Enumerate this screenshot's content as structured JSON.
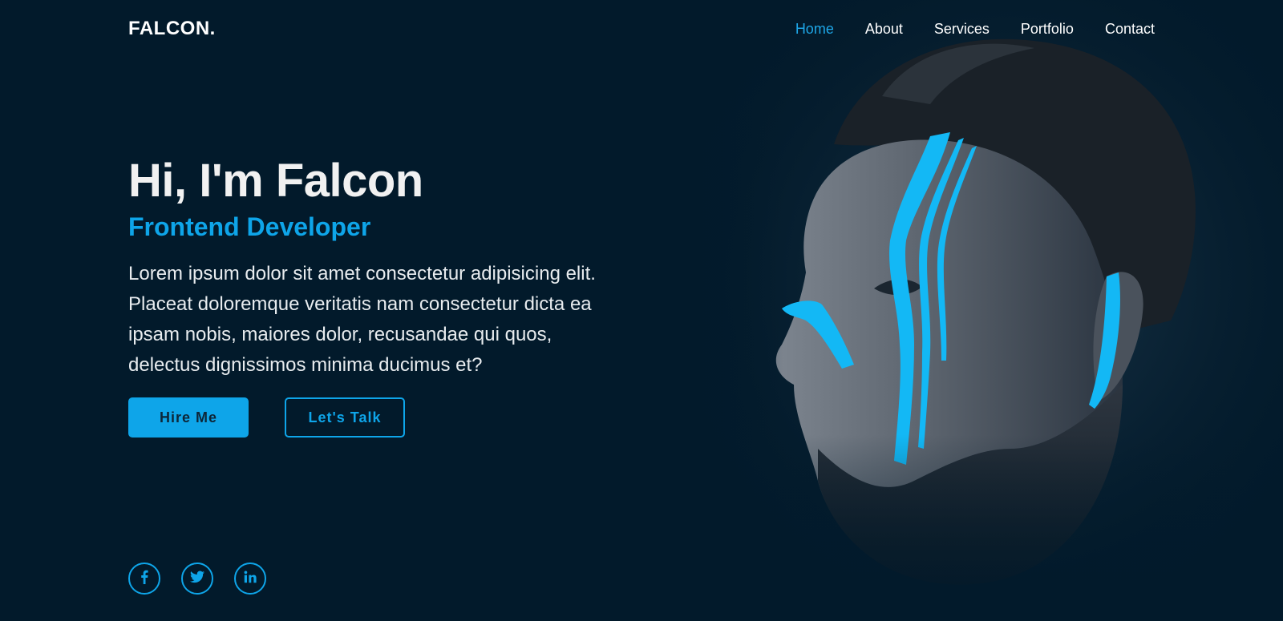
{
  "brand": {
    "logo": "FALCON."
  },
  "nav": {
    "items": [
      {
        "label": "Home",
        "active": true
      },
      {
        "label": "About",
        "active": false
      },
      {
        "label": "Services",
        "active": false
      },
      {
        "label": "Portfolio",
        "active": false
      },
      {
        "label": "Contact",
        "active": false
      }
    ]
  },
  "hero": {
    "title": "Hi, I'm Falcon",
    "subtitle": "Frontend Developer",
    "description": "Lorem ipsum dolor sit amet consectetur adipisicing elit. Placeat doloremque veritatis nam consectetur dicta ea ipsam nobis, maiores dolor, recusandae qui quos, delectus dignissimos minima ducimus et?",
    "primary_button": "Hire Me",
    "secondary_button": "Let's Talk"
  },
  "social": [
    {
      "icon": "facebook-icon"
    },
    {
      "icon": "twitter-icon"
    },
    {
      "icon": "linkedin-icon"
    }
  ],
  "colors": {
    "background": "#021a2b",
    "accent": "#0ea5e9",
    "text": "#ffffff"
  }
}
